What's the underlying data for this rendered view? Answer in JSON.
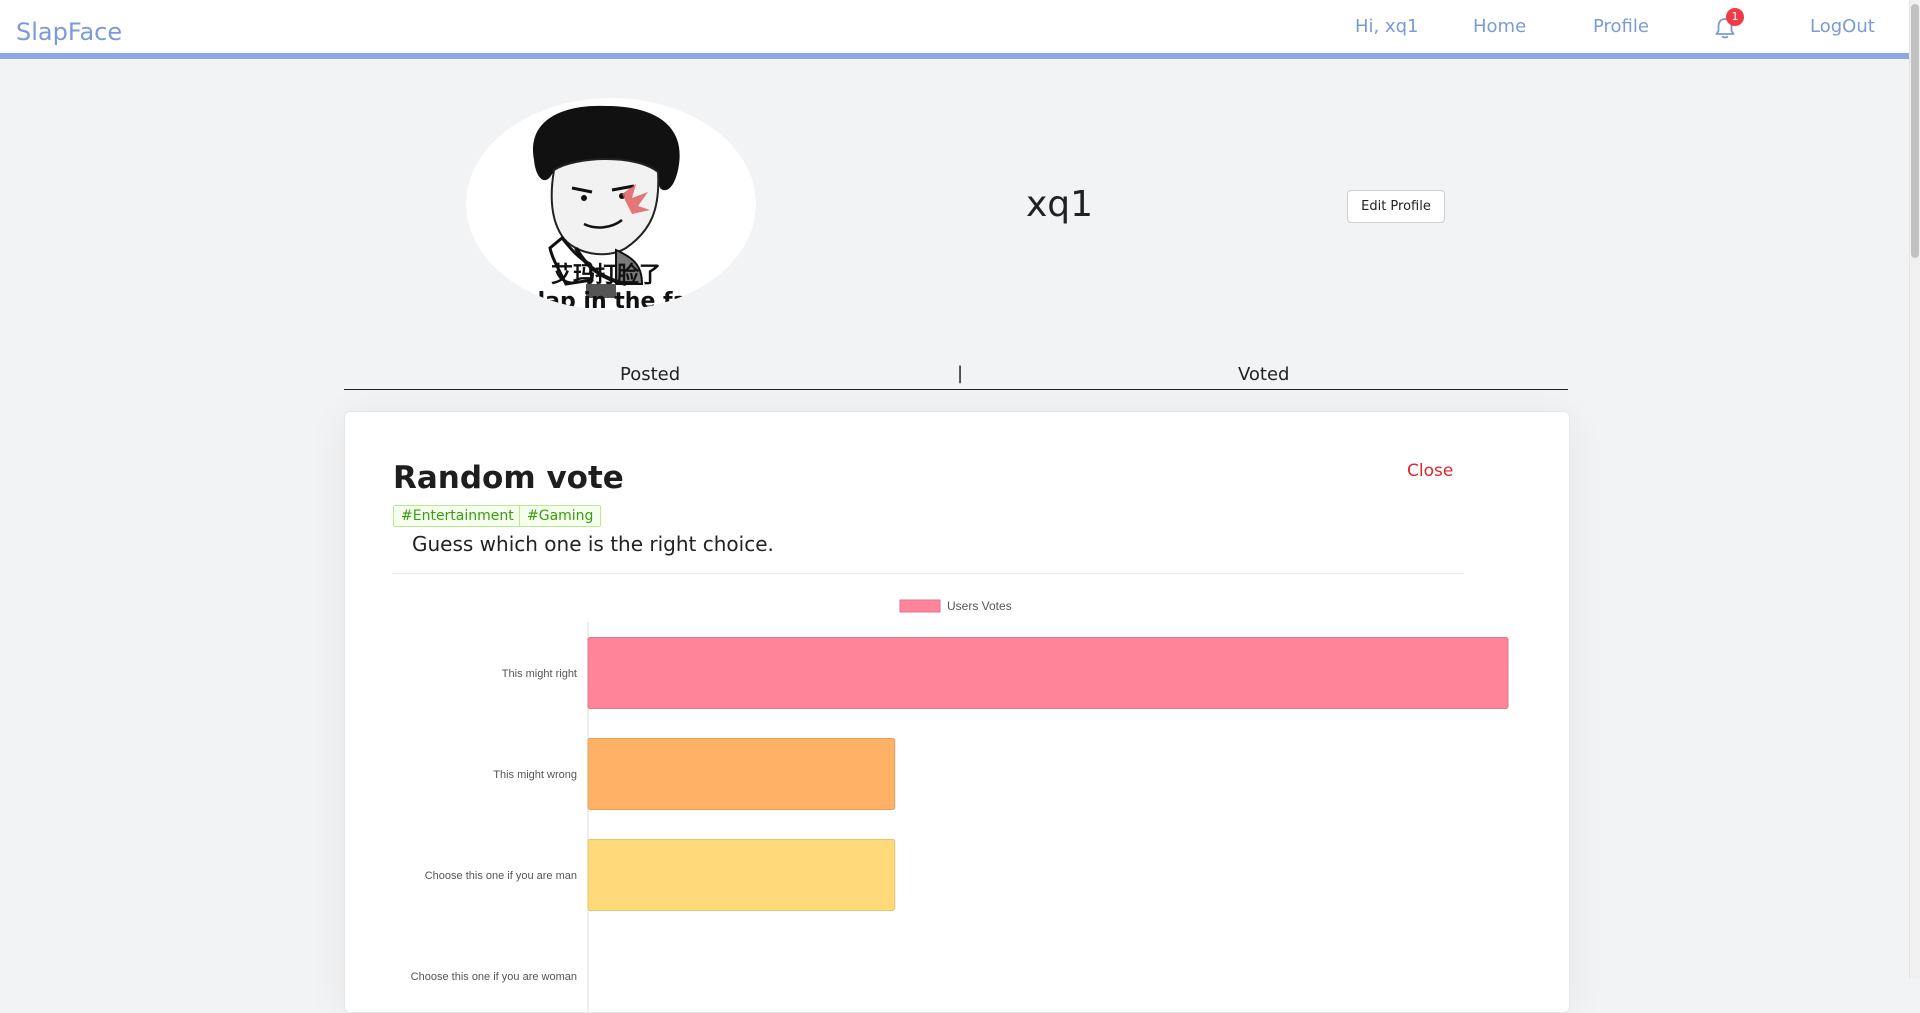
{
  "header": {
    "brand": "SlapFace",
    "greeting": "Hi, xq1",
    "home": "Home",
    "profile": "Profile",
    "notification_count": "1",
    "logout": "LogOut",
    "accent": "#7b9ad8"
  },
  "profile": {
    "avatar_caption_zh": "艾玛打脸了",
    "avatar_caption_en": "slap in the fa",
    "username": "xq1",
    "edit_label": "Edit Profile"
  },
  "tabs": {
    "posted": "Posted",
    "separator": "|",
    "voted": "Voted"
  },
  "vote": {
    "title": "Random vote",
    "close_label": "Close",
    "tags": [
      "#Entertainment",
      "#Gaming"
    ],
    "description": "Guess which one is the right choice."
  },
  "chart_data": {
    "type": "bar",
    "orientation": "horizontal",
    "legend_position": "top",
    "series": [
      {
        "name": "Users Votes",
        "values": [
          3,
          1,
          1,
          0
        ]
      }
    ],
    "categories": [
      "This might right",
      "This might wrong",
      "Choose this one if you are man",
      "Choose this one if you are woman"
    ],
    "colors": [
      "#ff8399",
      "#ffb266",
      "#ffd97a",
      "#7fd1d1"
    ],
    "xlim": [
      0,
      3
    ]
  }
}
